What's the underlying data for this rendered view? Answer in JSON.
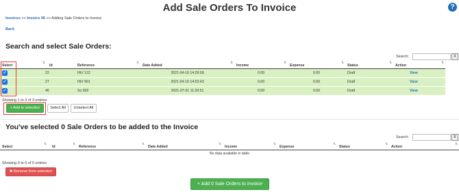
{
  "page": {
    "title": "Add Sale Orders To Invoice",
    "help_glyph": "?",
    "breadcrumb": {
      "invoices": "Invoices",
      "sep1": " >> ",
      "invoice": "Invoice 96",
      "sep2": " >> ",
      "current": "Adding Sale Orders to Invoice"
    },
    "back_label": "Back"
  },
  "search_section": {
    "heading": "Search and select Sale Orders:",
    "search_label": "Search:",
    "search_value": "",
    "clear_label": "X",
    "columns": [
      "Select",
      "Id",
      "Reference",
      "Date Added",
      "Income",
      "Expense",
      "Status",
      "Action"
    ],
    "rows": [
      {
        "checked": true,
        "id": "22",
        "reference": "INV 122",
        "date_added": "2021-04-16 14:26:58",
        "income": "0.00",
        "expense": "0.00",
        "status": "Draft",
        "action": "View"
      },
      {
        "checked": true,
        "id": "27",
        "reference": "INV 901",
        "date_added": "2021-04-16 14:52:43",
        "income": "0.00",
        "expense": "0.00",
        "status": "Draft",
        "action": "View"
      },
      {
        "checked": true,
        "id": "46",
        "reference": "So 902",
        "date_added": "2021-07-01 11:33:51",
        "income": "0.00",
        "expense": "0.00",
        "status": "Draft",
        "action": "View"
      }
    ],
    "info": "Showing 1 to 3 of 3 entries",
    "add_button": "+ Add to selection",
    "select_all": "Select All",
    "unselect_all": "Unselect All"
  },
  "selected_section": {
    "heading": "You've selected 0 Sale Orders to be added to the Invoice",
    "search_label": "Search:",
    "search_value": "",
    "clear_label": "X",
    "columns": [
      "Select",
      "Id",
      "Reference",
      "Date Added",
      "Income",
      "Expense",
      "Status",
      "Action"
    ],
    "empty_text": "No data available in table",
    "info": "Showing 0 to 0 of 0 entries",
    "remove_button": "✖ Remove from selection",
    "submit_button": "+ Add 0 Sale Orders to Invoice"
  },
  "colors": {
    "selected_row": "#d9f0c2",
    "green_button": "#4caf50",
    "red_button": "#e05252",
    "highlight_frame": "#e53935",
    "link": "#2a6fb3"
  },
  "icons": {
    "help": "question-circle-icon",
    "sort": "sort-arrows-icon",
    "checkbox": "checkbox-checked-icon"
  }
}
